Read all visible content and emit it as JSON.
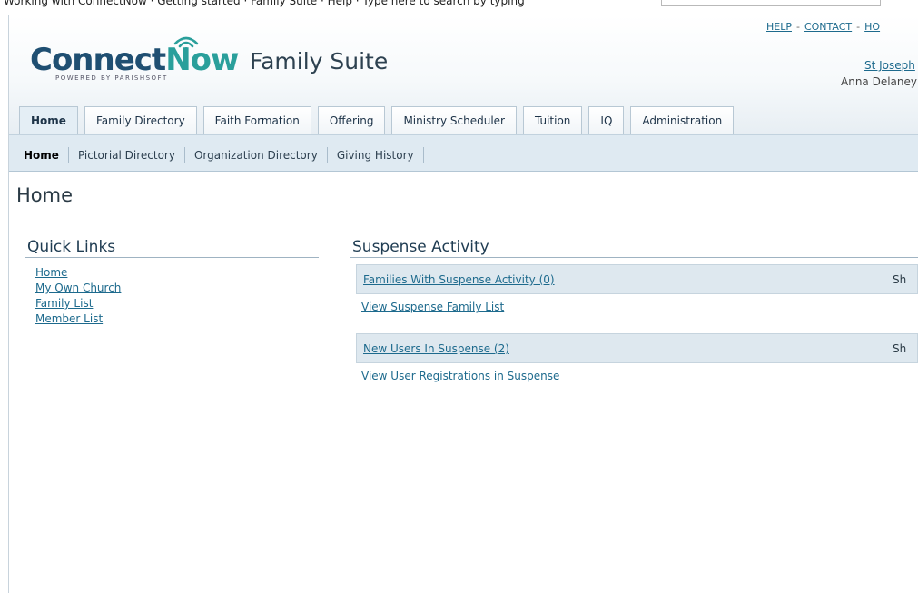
{
  "browser": {
    "top_strip_text": "Working  with  ConnectNow  ·  Getting  started  ·  Family  Suite  ·  Help  ·  Type  here  to  search  by  typing"
  },
  "header": {
    "logo_connect": "Connect",
    "logo_now": "Now",
    "logo_tagline": "POWERED BY PARISHSOFT",
    "app_title": "Family Suite",
    "links": [
      "HELP",
      "CONTACT",
      "HO"
    ],
    "parish_link": "St Joseph",
    "user_name": "Anna Delaney"
  },
  "tabs": [
    "Home",
    "Family Directory",
    "Faith Formation",
    "Offering",
    "Ministry Scheduler",
    "Tuition",
    "IQ",
    "Administration"
  ],
  "subnav": [
    "Home",
    "Pictorial Directory",
    "Organization Directory",
    "Giving History"
  ],
  "page": {
    "heading": "Home"
  },
  "quick_links": {
    "title": "Quick Links",
    "items": [
      "Home",
      "My Own Church",
      "Family List",
      "Member List"
    ]
  },
  "suspense": {
    "title": "Suspense Activity",
    "families_bar": "Families With Suspense Activity (0)",
    "families_show": "Sh",
    "families_link": "View Suspense Family List",
    "users_bar": "New Users In Suspense (2)",
    "users_show": "Sh",
    "users_link": "View User Registrations in Suspense"
  },
  "colors": {
    "link": "#1d6a8d",
    "brand_blue": "#1f4f72",
    "brand_teal": "#2a9f9b",
    "subnav_bg": "#dfeaf2"
  }
}
